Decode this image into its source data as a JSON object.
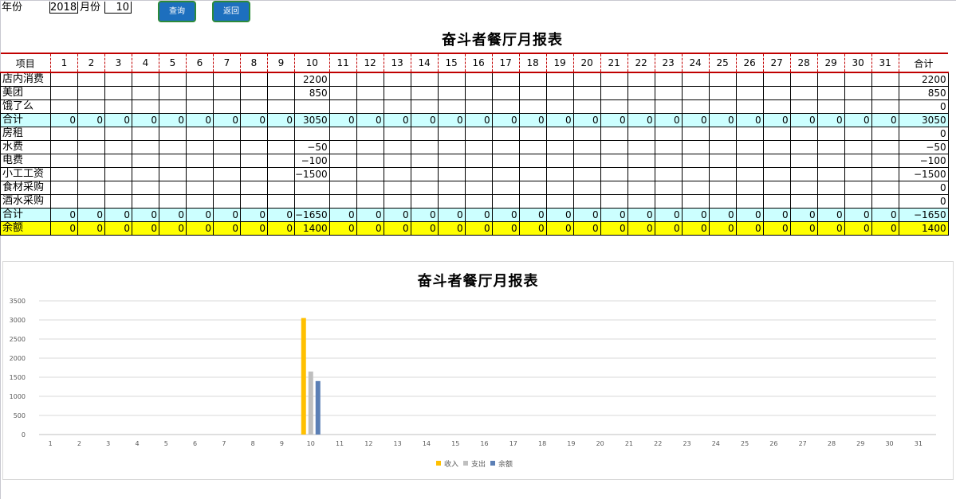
{
  "filter": {
    "year_label": "年份",
    "year_value": "2018",
    "month_label": "月份",
    "month_value": "10"
  },
  "buttons": {
    "query": "查询",
    "back": "返回"
  },
  "report": {
    "title": "奋斗者餐厅月报表",
    "header_first": "项目",
    "header_last": "合计",
    "days": [
      "1",
      "2",
      "3",
      "4",
      "5",
      "6",
      "7",
      "8",
      "9",
      "10",
      "11",
      "12",
      "13",
      "14",
      "15",
      "16",
      "17",
      "18",
      "19",
      "20",
      "21",
      "22",
      "23",
      "24",
      "25",
      "26",
      "27",
      "28",
      "29",
      "30",
      "31"
    ],
    "rows": [
      {
        "label": "店内消费",
        "type": "item",
        "day10": "2200",
        "total": "2200"
      },
      {
        "label": "美团",
        "type": "item",
        "day10": "850",
        "total": "850"
      },
      {
        "label": "饿了么",
        "type": "item",
        "day10": "",
        "total": "0"
      },
      {
        "label": "合计",
        "type": "sum",
        "day10": "3050",
        "total": "3050"
      },
      {
        "label": "房租",
        "type": "item",
        "day10": "",
        "total": "0"
      },
      {
        "label": "水费",
        "type": "item",
        "day10": "−50",
        "total": "−50"
      },
      {
        "label": "电费",
        "type": "item",
        "day10": "−100",
        "total": "−100"
      },
      {
        "label": "小工工资",
        "type": "item",
        "day10": "−1500",
        "total": "−1500"
      },
      {
        "label": "食材采购",
        "type": "item",
        "day10": "",
        "total": "0"
      },
      {
        "label": "酒水采购",
        "type": "item",
        "day10": "",
        "total": "0"
      },
      {
        "label": "合计",
        "type": "sum",
        "day10": "−1650",
        "total": "−1650"
      },
      {
        "label": "余额",
        "type": "bal",
        "day10": "1400",
        "total": "1400"
      }
    ]
  },
  "chart_data": {
    "type": "bar",
    "title": "奋斗者餐厅月报表",
    "categories": [
      "1",
      "2",
      "3",
      "4",
      "5",
      "6",
      "7",
      "8",
      "9",
      "10",
      "11",
      "12",
      "13",
      "14",
      "15",
      "16",
      "17",
      "18",
      "19",
      "20",
      "21",
      "22",
      "23",
      "24",
      "25",
      "26",
      "27",
      "28",
      "29",
      "30",
      "31"
    ],
    "series": [
      {
        "name": "收入",
        "color": "#ffc000",
        "values": [
          0,
          0,
          0,
          0,
          0,
          0,
          0,
          0,
          0,
          3050,
          0,
          0,
          0,
          0,
          0,
          0,
          0,
          0,
          0,
          0,
          0,
          0,
          0,
          0,
          0,
          0,
          0,
          0,
          0,
          0,
          0
        ]
      },
      {
        "name": "支出",
        "color": "#bfbfbf",
        "values": [
          0,
          0,
          0,
          0,
          0,
          0,
          0,
          0,
          0,
          1650,
          0,
          0,
          0,
          0,
          0,
          0,
          0,
          0,
          0,
          0,
          0,
          0,
          0,
          0,
          0,
          0,
          0,
          0,
          0,
          0,
          0
        ]
      },
      {
        "name": "余额",
        "color": "#5b7fb5",
        "values": [
          0,
          0,
          0,
          0,
          0,
          0,
          0,
          0,
          0,
          1400,
          0,
          0,
          0,
          0,
          0,
          0,
          0,
          0,
          0,
          0,
          0,
          0,
          0,
          0,
          0,
          0,
          0,
          0,
          0,
          0,
          0
        ]
      }
    ],
    "yticks": [
      "0",
      "500",
      "1000",
      "1500",
      "2000",
      "2500",
      "3000",
      "3500"
    ],
    "ylim": [
      0,
      3500
    ],
    "grid": true,
    "legend": "bottom"
  }
}
